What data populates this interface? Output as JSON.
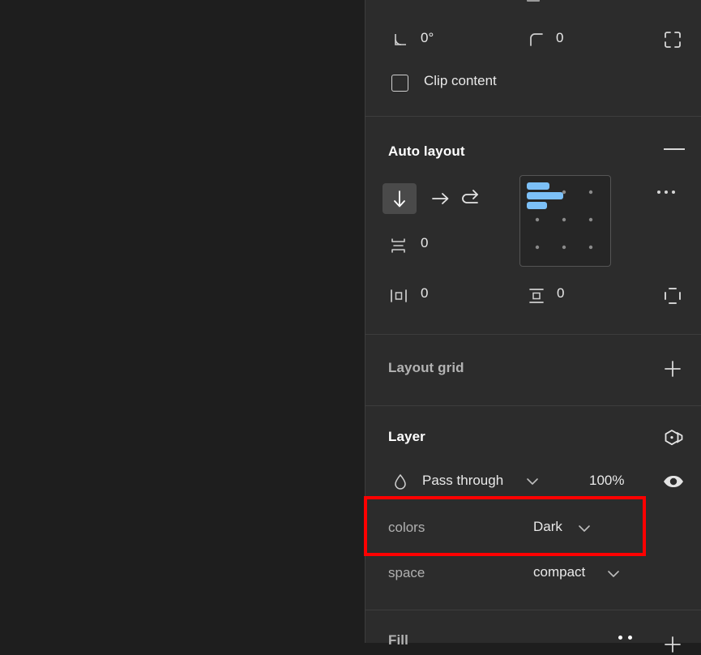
{
  "app": "figma-properties-panel",
  "canvas": {
    "background_color": "#1e1e1e",
    "scrollbar": {
      "name": "canvas-vertical-scrollbar"
    }
  },
  "panel": {
    "background_color": "#2c2c2c",
    "divider_color": "#3d3d3d",
    "transform": {
      "rotation_icon": "rotation-icon",
      "rotation_value": "0°",
      "corner_radius_icon": "corner-radius-icon",
      "corner_radius_value": "0",
      "independent_corners_icon": "independent-corners-icon",
      "clip_content_label": "Clip content",
      "clip_content_checked": false
    },
    "auto_layout": {
      "title": "Auto layout",
      "remove_label": "—",
      "direction_vertical_icon": "arrow-down-icon",
      "direction_vertical_selected": true,
      "direction_horizontal_icon": "arrow-right-icon",
      "direction_wrap_icon": "wrap-icon",
      "alignment_grid": {
        "name": "alignment-picker",
        "selected": "top-left",
        "accent_color": "#7cc0f7"
      },
      "more_options_icon": "more-horizontal-icon",
      "gap_icon": "vertical-gap-icon",
      "gap_value": "0",
      "horizontal_padding_icon": "horizontal-padding-icon",
      "horizontal_padding_value": "0",
      "vertical_padding_icon": "vertical-padding-icon",
      "vertical_padding_value": "0",
      "individual_padding_icon": "individual-padding-icon"
    },
    "layout_grid": {
      "title": "Layout grid",
      "add_icon": "plus-icon"
    },
    "layer": {
      "title": "Layer",
      "variable_mode_icon": "variable-mode-icon",
      "blend_mode_icon": "blend-mode-icon",
      "blend_mode_value": "Pass through",
      "blend_caret_icon": "chevron-down-icon",
      "opacity_value": "100%",
      "visibility_icon": "eye-icon",
      "properties": [
        {
          "label": "colors",
          "value": "Dark",
          "caret_icon": "chevron-down-icon",
          "highlighted": true
        },
        {
          "label": "space",
          "value": "compact",
          "caret_icon": "chevron-down-icon",
          "highlighted": false
        }
      ]
    },
    "fill": {
      "title": "Fill",
      "more_icon": "more-dots-icon",
      "add_icon": "plus-icon"
    }
  },
  "annotation": {
    "name": "red-highlight-box",
    "color": "#ff0000",
    "targets": "colors-property-row"
  }
}
